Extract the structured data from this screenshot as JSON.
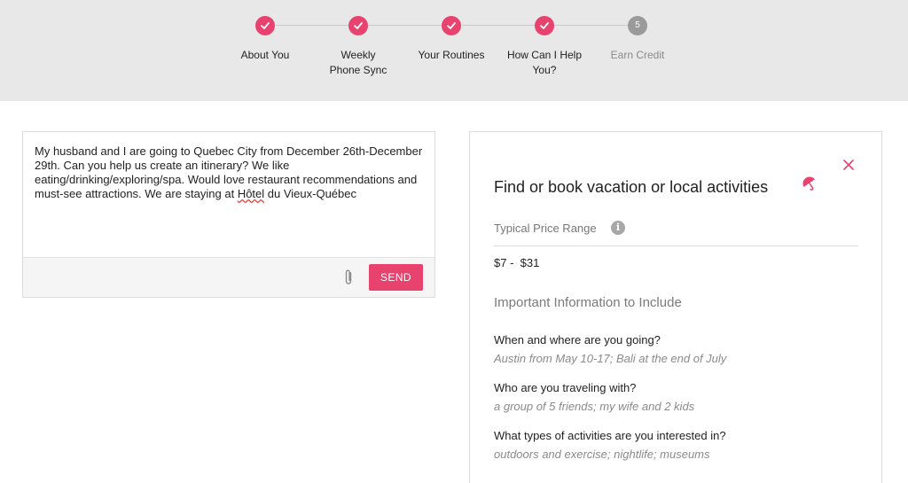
{
  "stepper": {
    "steps": [
      {
        "label": "About You",
        "status": "complete"
      },
      {
        "label": "Weekly Phone Sync",
        "status": "complete"
      },
      {
        "label": "Your Routines",
        "status": "complete"
      },
      {
        "label": "How Can I Help You?",
        "status": "complete"
      },
      {
        "label": "Earn Credit",
        "status": "pending",
        "number": "5"
      }
    ]
  },
  "composer": {
    "message_before": "My husband and I are going to Quebec City from December 26th-December 29th. Can you help us create an itinerary? We like eating/drinking/exploring/spa. Would love restaurant recommendations and must-see attractions. We are staying at ",
    "message_misspelled": "Hôtel",
    "message_after": " du Vieux-Québec",
    "send_label": "SEND"
  },
  "panel": {
    "title": "Find or book vacation or local activities",
    "price_label": "Typical Price Range",
    "price_value": "$7 -  $31",
    "section_heading": "Important Information to Include",
    "items": [
      {
        "question": "When and where are you going?",
        "example": "Austin from May 10-17; Bali at the end of July"
      },
      {
        "question": "Who are you traveling with?",
        "example": "a group of 5 friends; my wife and 2 kids"
      },
      {
        "question": "What types of activities are you interested in?",
        "example": "outdoors and exercise; nightlife; museums"
      }
    ]
  },
  "colors": {
    "accent": "#e8426f",
    "header_bg": "#e8e8e8",
    "pending_step": "#9a9a9a"
  },
  "icons": {
    "complete_step": "check-icon",
    "attach": "paperclip-icon",
    "close": "close-icon",
    "category": "umbrella-icon",
    "info": "info-icon"
  }
}
